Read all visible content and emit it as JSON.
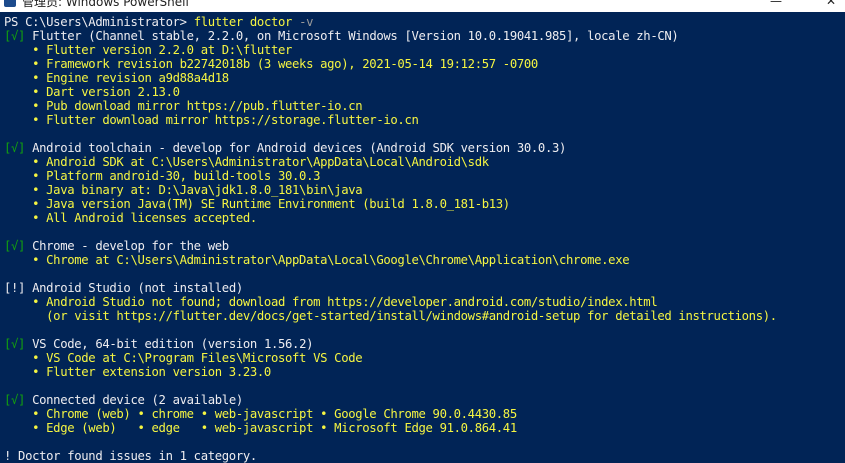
{
  "window": {
    "title": "管理员: Windows PowerShell",
    "minimize": "—",
    "close": "✕"
  },
  "colors": {
    "background": "#012456",
    "text": "#eeedf0",
    "highlight": "#f5f542",
    "success": "#13a10e"
  },
  "terminal": {
    "prompt": "PS C:\\Users\\Administrator>",
    "command": "flutter doctor",
    "command_flag": "-v",
    "sections": [
      {
        "status": "[√]",
        "status_kind": "ok",
        "heading": "Flutter (Channel stable, 2.2.0, on Microsoft Windows [Version 10.0.19041.985], locale zh-CN)",
        "details": [
          "Flutter version 2.2.0 at D:\\flutter",
          "Framework revision b22742018b (3 weeks ago), 2021-05-14 19:12:57 -0700",
          "Engine revision a9d88a4d18",
          "Dart version 2.13.0",
          "Pub download mirror https://pub.flutter-io.cn",
          "Flutter download mirror https://storage.flutter-io.cn"
        ]
      },
      {
        "status": "[√]",
        "status_kind": "ok",
        "heading": "Android toolchain - develop for Android devices (Android SDK version 30.0.3)",
        "details": [
          "Android SDK at C:\\Users\\Administrator\\AppData\\Local\\Android\\sdk",
          "Platform android-30, build-tools 30.0.3",
          "Java binary at: D:\\Java\\jdk1.8.0_181\\bin\\java",
          "Java version Java(TM) SE Runtime Environment (build 1.8.0_181-b13)",
          "All Android licenses accepted."
        ]
      },
      {
        "status": "[√]",
        "status_kind": "ok",
        "heading": "Chrome - develop for the web",
        "details": [
          "Chrome at C:\\Users\\Administrator\\AppData\\Local\\Google\\Chrome\\Application\\chrome.exe"
        ]
      },
      {
        "status": "[!]",
        "status_kind": "warn",
        "heading": "Android Studio (not installed)",
        "details": [
          "Android Studio not found; download from https://developer.android.com/studio/index.html"
        ],
        "continuation": "(or visit https://flutter.dev/docs/get-started/install/windows#android-setup for detailed instructions)."
      },
      {
        "status": "[√]",
        "status_kind": "ok",
        "heading": "VS Code, 64-bit edition (version 1.56.2)",
        "details": [
          "VS Code at C:\\Program Files\\Microsoft VS Code",
          "Flutter extension version 3.23.0"
        ]
      },
      {
        "status": "[√]",
        "status_kind": "ok",
        "heading": "Connected device (2 available)",
        "details": [
          "Chrome (web) • chrome • web-javascript • Google Chrome 90.0.4430.85",
          "Edge (web)   • edge   • web-javascript • Microsoft Edge 91.0.864.41"
        ]
      }
    ],
    "summary": "! Doctor found issues in 1 category."
  }
}
